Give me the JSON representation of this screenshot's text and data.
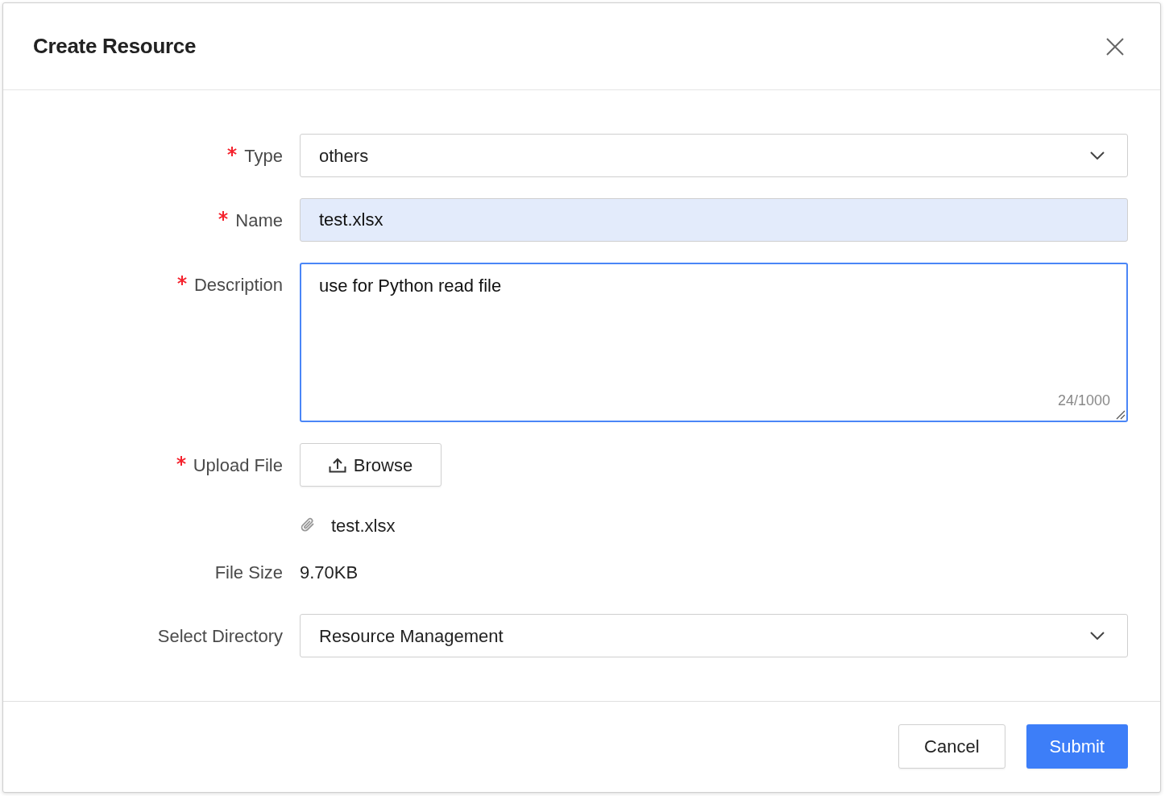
{
  "dialog": {
    "title": "Create Resource",
    "fields": [
      {
        "kind": "select",
        "label": "Type",
        "required": true,
        "value": "others"
      },
      {
        "kind": "input",
        "label": "Name",
        "required": true,
        "value": "test.xlsx",
        "autofilled": true
      },
      {
        "kind": "textarea",
        "label": "Description",
        "required": true,
        "value": "use for Python read file",
        "counter": "24/1000",
        "focused": true
      },
      {
        "kind": "upload",
        "label": "Upload File",
        "required": true,
        "button": "Browse",
        "files": [
          {
            "name": "test.xlsx"
          }
        ]
      },
      {
        "kind": "text",
        "label": "File Size",
        "required": false,
        "value": "9.70KB"
      },
      {
        "kind": "select",
        "label": "Select Directory",
        "required": false,
        "value": "Resource Management"
      }
    ],
    "buttons": [
      {
        "label": "Cancel",
        "primary": false
      },
      {
        "label": "Submit",
        "primary": true
      }
    ]
  }
}
